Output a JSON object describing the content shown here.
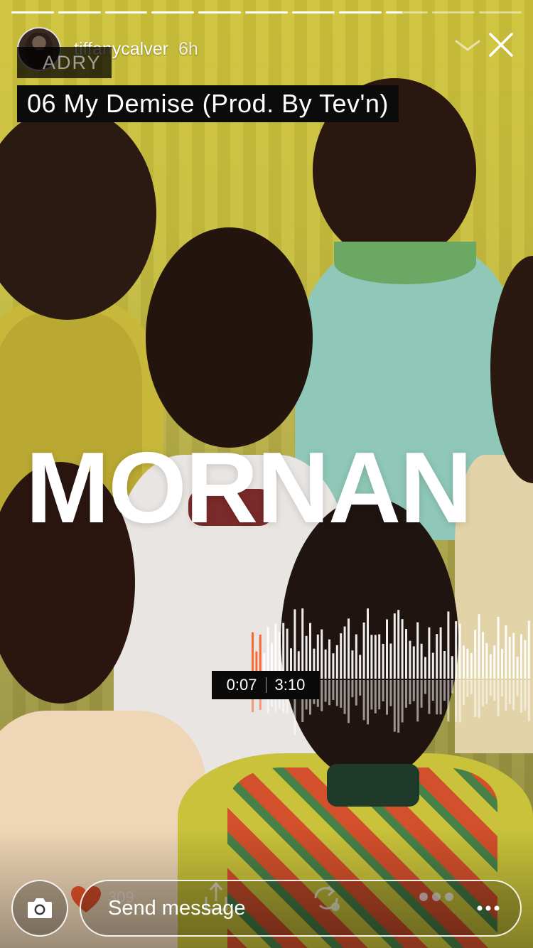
{
  "story": {
    "username": "tiffanycalver",
    "time_ago": "6h",
    "progress": {
      "segments_total": 11,
      "segments_complete": 8,
      "current_segment_fraction": 0.4
    }
  },
  "track": {
    "artist_partial": "ADRY",
    "title": "06 My Demise (Prod. By Tev'n)",
    "cover_word": "MORNAN",
    "elapsed": "0:07",
    "duration": "3:10",
    "played_fraction": 0.04
  },
  "background_overlay": {
    "like_count": "309"
  },
  "footer": {
    "message_placeholder": "Send message"
  },
  "colors": {
    "waveform_played": "#ff5a1f",
    "waveform_unplayed": "#ffffff"
  },
  "icons": {
    "camera": "camera-icon",
    "more": "more-horizontal-icon",
    "close": "close-icon",
    "chevron": "chevron-down-icon",
    "heart": "heart-icon",
    "share": "share-icon",
    "repost": "repost-icon"
  }
}
